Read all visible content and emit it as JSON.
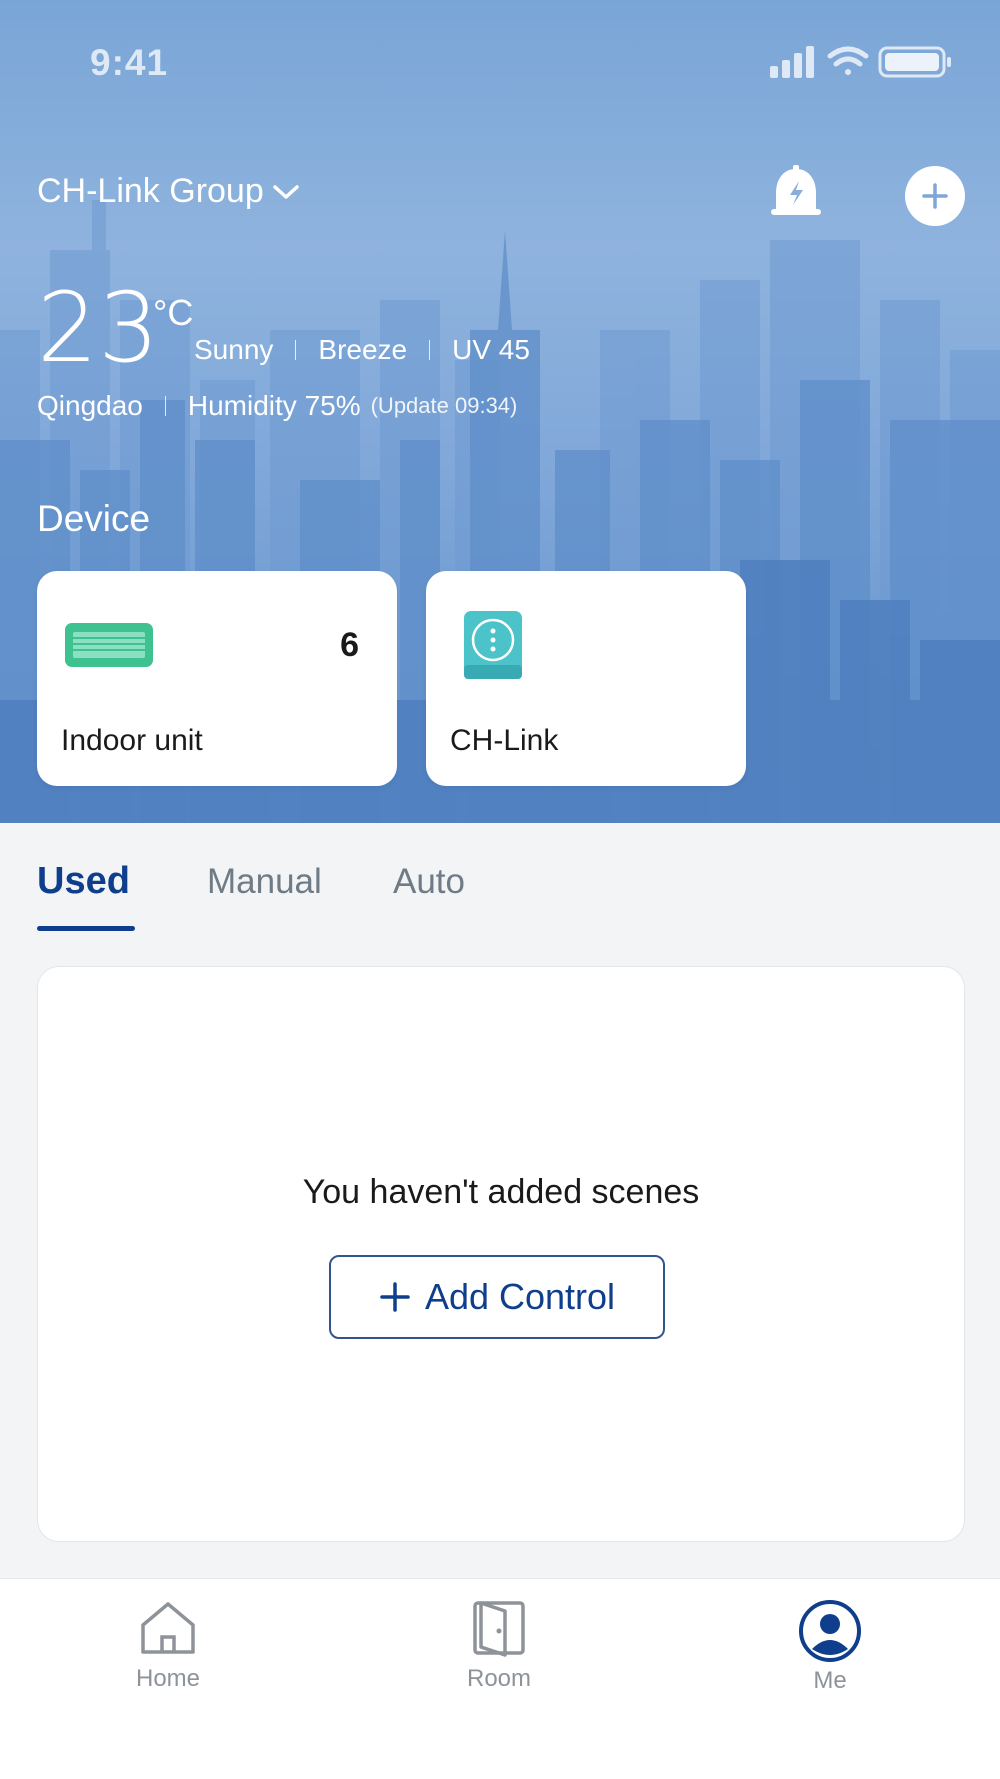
{
  "status_bar": {
    "time": "9:41"
  },
  "header": {
    "group_name": "CH-Link Group",
    "bell_icon": "alarm-bell-icon",
    "add_icon": "plus-icon"
  },
  "weather": {
    "temperature": "23",
    "unit": "°C",
    "condition": "Sunny",
    "wind": "Breeze",
    "uv": "UV 45",
    "city": "Qingdao",
    "humidity": "Humidity 75%",
    "update": "(Update 09:34)"
  },
  "devices": {
    "title": "Device",
    "items": [
      {
        "name": "Indoor unit",
        "count": "6",
        "icon": "indoor-unit-icon"
      },
      {
        "name": "CH-Link",
        "icon": "ch-link-device-icon"
      }
    ]
  },
  "scene_tabs": [
    {
      "label": "Used",
      "active": true
    },
    {
      "label": "Manual",
      "active": false
    },
    {
      "label": "Auto",
      "active": false
    }
  ],
  "scenes": {
    "empty_text": "You haven't added scenes",
    "add_button": "Add Control"
  },
  "bottom_nav": [
    {
      "label": "Home",
      "icon": "home-icon",
      "active": false
    },
    {
      "label": "Room",
      "icon": "door-icon",
      "active": false
    },
    {
      "label": "Me",
      "icon": "user-profile-icon",
      "active": true
    }
  ],
  "colors": {
    "accent": "#0e3e8c",
    "hero_sky": "#8fb3de",
    "indoor_unit_icon": "#3ec28f",
    "ch_link_icon": "#4cc3c9"
  }
}
